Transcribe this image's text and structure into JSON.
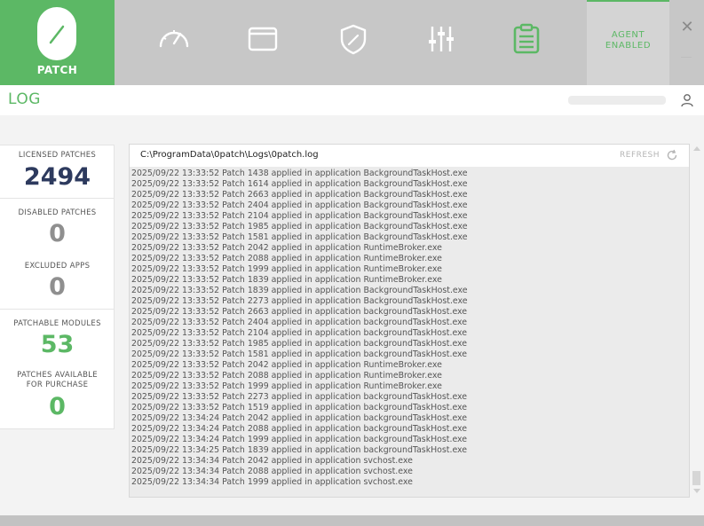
{
  "app": {
    "logo_label": "PATCH",
    "brand_color": "#5cb865"
  },
  "nav": {
    "items": [
      {
        "name": "dashboard",
        "icon": "speedometer-icon",
        "active": false
      },
      {
        "name": "applications",
        "icon": "window-icon",
        "active": false
      },
      {
        "name": "security",
        "icon": "shield-icon",
        "active": false
      },
      {
        "name": "settings",
        "icon": "sliders-icon",
        "active": false
      },
      {
        "name": "log",
        "icon": "clipboard-icon",
        "active": true
      }
    ]
  },
  "agent": {
    "line1": "AGENT",
    "line2": "ENABLED"
  },
  "window": {
    "close_label": "✕"
  },
  "page": {
    "title": "LOG"
  },
  "stats": {
    "licensed": {
      "label": "LICENSED PATCHES",
      "value": "2494",
      "color": "#2d3a5e"
    },
    "disabled": {
      "label": "DISABLED PATCHES",
      "value": "0",
      "color": "#8f8f8f"
    },
    "excluded": {
      "label": "EXCLUDED APPS",
      "value": "0",
      "color": "#8f8f8f"
    },
    "patchable": {
      "label": "PATCHABLE MODULES",
      "value": "53",
      "color": "#5cb865"
    },
    "available": {
      "label1": "PATCHES AVAILABLE",
      "label2": "FOR PURCHASE",
      "value": "0",
      "color": "#5cb865"
    }
  },
  "log": {
    "path": "C:\\ProgramData\\0patch\\Logs\\0patch.log",
    "refresh_label": "REFRESH",
    "lines": [
      "2025/09/22 13:33:52 Patch 1438 applied in application BackgroundTaskHost.exe",
      "2025/09/22 13:33:52 Patch 1614 applied in application BackgroundTaskHost.exe",
      "2025/09/22 13:33:52 Patch 2663 applied in application BackgroundTaskHost.exe",
      "2025/09/22 13:33:52 Patch 2404 applied in application BackgroundTaskHost.exe",
      "2025/09/22 13:33:52 Patch 2104 applied in application BackgroundTaskHost.exe",
      "2025/09/22 13:33:52 Patch 1985 applied in application BackgroundTaskHost.exe",
      "2025/09/22 13:33:52 Patch 1581 applied in application BackgroundTaskHost.exe",
      "2025/09/22 13:33:52 Patch 2042 applied in application RuntimeBroker.exe",
      "2025/09/22 13:33:52 Patch 2088 applied in application RuntimeBroker.exe",
      "2025/09/22 13:33:52 Patch 1999 applied in application RuntimeBroker.exe",
      "2025/09/22 13:33:52 Patch 1839 applied in application RuntimeBroker.exe",
      "2025/09/22 13:33:52 Patch 1839 applied in application BackgroundTaskHost.exe",
      "2025/09/22 13:33:52 Patch 2273 applied in application BackgroundTaskHost.exe",
      "2025/09/22 13:33:52 Patch 2663 applied in application backgroundTaskHost.exe",
      "2025/09/22 13:33:52 Patch 2404 applied in application backgroundTaskHost.exe",
      "2025/09/22 13:33:52 Patch 2104 applied in application backgroundTaskHost.exe",
      "2025/09/22 13:33:52 Patch 1985 applied in application backgroundTaskHost.exe",
      "2025/09/22 13:33:52 Patch 1581 applied in application backgroundTaskHost.exe",
      "2025/09/22 13:33:52 Patch 2042 applied in application RuntimeBroker.exe",
      "2025/09/22 13:33:52 Patch 2088 applied in application RuntimeBroker.exe",
      "2025/09/22 13:33:52 Patch 1999 applied in application RuntimeBroker.exe",
      "2025/09/22 13:33:52 Patch 2273 applied in application backgroundTaskHost.exe",
      "2025/09/22 13:33:52 Patch 1519 applied in application backgroundTaskHost.exe",
      "2025/09/22 13:34:24 Patch 2042 applied in application backgroundTaskHost.exe",
      "2025/09/22 13:34:24 Patch 2088 applied in application backgroundTaskHost.exe",
      "2025/09/22 13:34:24 Patch 1999 applied in application backgroundTaskHost.exe",
      "2025/09/22 13:34:25 Patch 1839 applied in application backgroundTaskHost.exe",
      "2025/09/22 13:34:34 Patch 2042 applied in application svchost.exe",
      "2025/09/22 13:34:34 Patch 2088 applied in application svchost.exe",
      "2025/09/22 13:34:34 Patch 1999 applied in application svchost.exe"
    ]
  }
}
